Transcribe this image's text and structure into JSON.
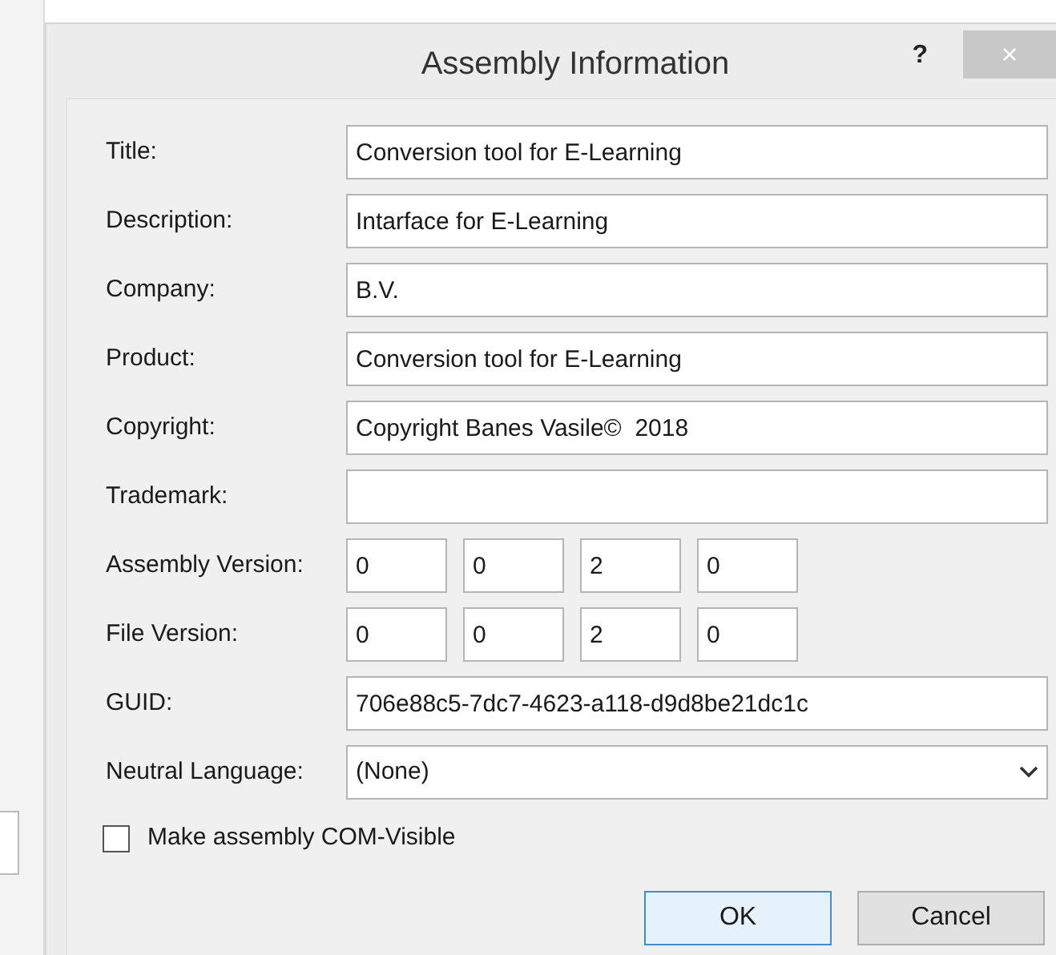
{
  "window": {
    "title": "Assembly Information",
    "help": "?",
    "close": "×"
  },
  "fields": [
    {
      "label": "Title:",
      "kind": "text",
      "value": "Conversion tool for E-Learning"
    },
    {
      "label": "Description:",
      "kind": "text",
      "value": "Intarface for E-Learning"
    },
    {
      "label": "Company:",
      "kind": "text",
      "value": "B.V."
    },
    {
      "label": "Product:",
      "kind": "text",
      "value": "Conversion tool for E-Learning"
    },
    {
      "label": "Copyright:",
      "kind": "text",
      "value": "Copyright Banes Vasile©  2018"
    },
    {
      "label": "Trademark:",
      "kind": "text"
    },
    {
      "label": "Assembly Version:",
      "kind": "version",
      "parts": [
        "0",
        "0",
        "2",
        "0"
      ]
    },
    {
      "label": "File Version:",
      "kind": "version",
      "parts": [
        "0",
        "0",
        "2",
        "0"
      ]
    },
    {
      "label": "GUID:",
      "kind": "text",
      "value": "706e88c5-7dc7-4623-a118-d9d8be21dc1c"
    },
    {
      "label": "Neutral Language:",
      "kind": "dropdown",
      "value": "(None)"
    }
  ],
  "checkbox": {
    "label": "Make assembly COM-Visible",
    "checked": false
  },
  "buttons": [
    {
      "label": "OK",
      "default": true
    },
    {
      "label": "Cancel",
      "default": false
    }
  ]
}
